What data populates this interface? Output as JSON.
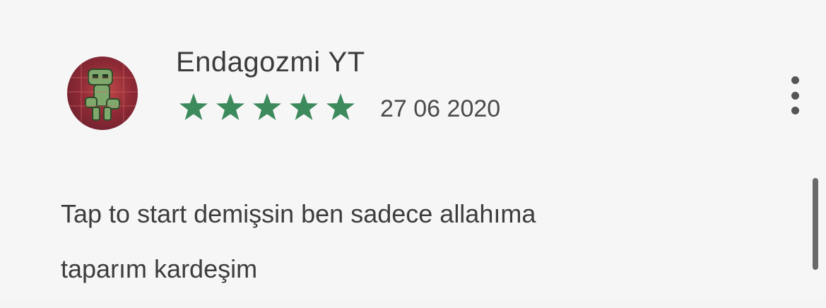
{
  "review": {
    "author": "Endagozmi YT",
    "rating": 5,
    "rating_max": 5,
    "date": "27 06 2020",
    "text_lines": [
      "Tap to start demişsin ben sadece allahıma",
      "taparım kardeşim"
    ]
  },
  "colors": {
    "star": "#3d8a5c",
    "text": "#3d3d3d"
  },
  "icons": {
    "menu": "more-vert-icon",
    "avatar": "user-avatar"
  }
}
